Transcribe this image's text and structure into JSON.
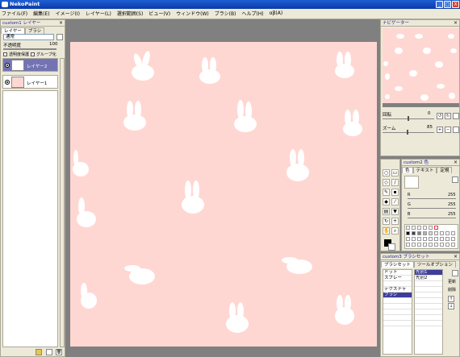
{
  "app": {
    "title": "NekoPaint"
  },
  "window_buttons": [
    "_",
    "□",
    "X"
  ],
  "menu": [
    "ファイル(F)",
    "編集(E)",
    "イメージ(I)",
    "レイヤー(L)",
    "選択範囲(S)",
    "ビュー(V)",
    "ウィンドウ(W)",
    "ブラシ(B)",
    "ヘルプ(H)",
    "αβ(A)"
  ],
  "layer_panel": {
    "title": "custom1 レイヤー",
    "tabs": [
      "レイヤー",
      "ブラシ"
    ],
    "blend_mode": "通常",
    "opacity_label": "不透明度",
    "opacity_value": "100",
    "check_transparency": "透明度保護",
    "check_group": "グループ化",
    "layers": [
      {
        "name": "レイヤー2",
        "selected": true
      },
      {
        "name": "レイヤー1",
        "selected": false
      }
    ]
  },
  "navigator": {
    "title": "ナビゲーター",
    "rotate_label": "回転",
    "rotate_value": "0",
    "zoom_label": "ズーム",
    "zoom_value": "85"
  },
  "color_panel": {
    "title": "custom2 色",
    "tabs": [
      "色",
      "テキスト",
      "定規"
    ],
    "r_label": "R",
    "r_value": "255",
    "g_label": "G",
    "g_value": "255",
    "b_label": "B",
    "b_value": "255"
  },
  "brush_panel": {
    "title": "custom3 ブラシセット",
    "tabs": [
      "ブラシセット",
      "ツールオプション"
    ],
    "categories": [
      "ドット",
      "スプレー",
      "",
      "テクスチャ",
      "ブラシ"
    ],
    "selected_category": 4,
    "presets": [
      "先別1",
      "先別2"
    ],
    "selected_preset": 0,
    "buttons": [
      "更新",
      "削除"
    ]
  },
  "colors": {
    "canvas": "#ffd7d2",
    "selection": "#7373b4",
    "title_gradient": "#1d5fd4"
  }
}
